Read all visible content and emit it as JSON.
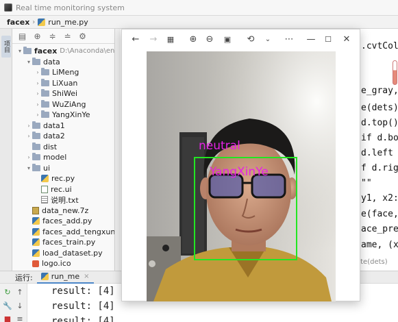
{
  "window": {
    "title": "Real time monitoring system"
  },
  "breadcrumb": {
    "project": "facex",
    "file": "run_me.py"
  },
  "left_strip": {
    "project_tab": "项目"
  },
  "project_tree": {
    "root": {
      "name": "facex",
      "path": "D:\\Anaconda\\envs\\"
    },
    "items": [
      {
        "name": "data",
        "type": "folder",
        "expanded": true,
        "depth": 1
      },
      {
        "name": "LiMeng",
        "type": "folder",
        "expanded": false,
        "depth": 2
      },
      {
        "name": "LiXuan",
        "type": "folder",
        "expanded": false,
        "depth": 2
      },
      {
        "name": "ShiWei",
        "type": "folder",
        "expanded": false,
        "depth": 2
      },
      {
        "name": "WuZiAng",
        "type": "folder",
        "expanded": false,
        "depth": 2
      },
      {
        "name": "YangXinYe",
        "type": "folder",
        "expanded": false,
        "depth": 2
      },
      {
        "name": "data1",
        "type": "folder",
        "expanded": false,
        "depth": 1
      },
      {
        "name": "data2",
        "type": "folder",
        "expanded": false,
        "depth": 1
      },
      {
        "name": "dist",
        "type": "folder",
        "expanded": null,
        "depth": 1
      },
      {
        "name": "model",
        "type": "folder",
        "expanded": false,
        "depth": 1
      },
      {
        "name": "ui",
        "type": "folder",
        "expanded": true,
        "depth": 1
      },
      {
        "name": "rec.py",
        "type": "py",
        "depth": 2
      },
      {
        "name": "rec.ui",
        "type": "ui",
        "depth": 2
      },
      {
        "name": "说明.txt",
        "type": "txt",
        "depth": 2
      },
      {
        "name": "data_new.7z",
        "type": "7z",
        "depth": 1
      },
      {
        "name": "faces_add.py",
        "type": "py",
        "depth": 1
      },
      {
        "name": "faces_add_tengxun.py",
        "type": "py",
        "depth": 1
      },
      {
        "name": "faces_train.py",
        "type": "py",
        "depth": 1
      },
      {
        "name": "load_dataset.py",
        "type": "py",
        "depth": 1
      },
      {
        "name": "logo.ico",
        "type": "ico",
        "depth": 1
      }
    ]
  },
  "editor": {
    "lines": [
      ".cvtColo",
      "e_gray,",
      "e(dets)",
      "d.top()",
      "if d.bo",
      " d.left",
      "f d.rig",
      "\"\"",
      "y1, x2:",
      "e(face,",
      "ace_pre",
      "ame, (x"
    ],
    "hint": "ate(dets)"
  },
  "run_panel": {
    "label": "运行:",
    "tab": "run_me",
    "output": [
      "result: [4]",
      "result: [4]",
      "result: [4]"
    ]
  },
  "viewer": {
    "detections": [
      {
        "emotion": "neutral",
        "name": "YangXinYe"
      }
    ],
    "colors": {
      "box": "#22e622",
      "label": "#e622e6"
    }
  }
}
